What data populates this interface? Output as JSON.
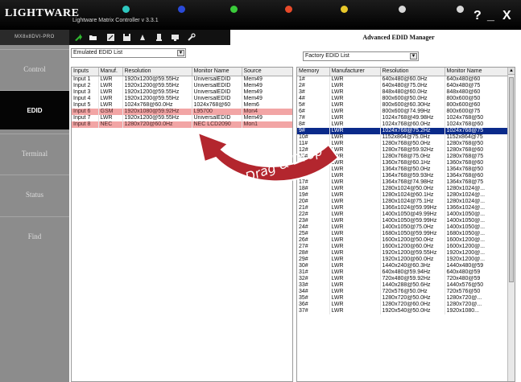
{
  "app": {
    "logo": "LIGHTWARE",
    "title": "Lightware Matrix Controller v 3.3.1",
    "model": "MX8x8DVI-PRO",
    "status_leds": [
      {
        "name": "led-1",
        "color": "#2ec8c0"
      },
      {
        "name": "led-2",
        "color": "#2a4ad8"
      },
      {
        "name": "led-3",
        "color": "#3acb3a"
      },
      {
        "name": "led-4",
        "color": "#e84a2a"
      },
      {
        "name": "led-5",
        "color": "#e8c82a"
      },
      {
        "name": "led-6",
        "color": "#d8d8d8"
      },
      {
        "name": "led-7",
        "color": "#d8d8d8"
      }
    ],
    "help_label": "?",
    "minimize_label": "_",
    "close_label": "X"
  },
  "sidebar": {
    "items": [
      {
        "id": "control",
        "label": "Control",
        "active": false
      },
      {
        "id": "edid",
        "label": "EDID",
        "active": true
      },
      {
        "id": "terminal",
        "label": "Terminal",
        "active": false
      },
      {
        "id": "status",
        "label": "Status",
        "active": false
      },
      {
        "id": "find",
        "label": "Find",
        "active": false
      }
    ]
  },
  "toolbar": {
    "tools": [
      "green-arrow-icon",
      "open-folder-icon",
      "edit-icon",
      "save-icon",
      "paint-icon",
      "document-icon",
      "monitor-icon",
      "wrench-icon"
    ]
  },
  "left": {
    "select_value": "Emulated EDID List",
    "columns": [
      "Inputs",
      "Manuf.",
      "Resolution",
      "Monitor Name",
      "Source"
    ],
    "rows": [
      {
        "cells": [
          "Input 1",
          "LWR",
          "1920x1200@59.55Hz",
          "UniversalEDID",
          "Mem49"
        ],
        "hl": false
      },
      {
        "cells": [
          "Input 2",
          "LWR",
          "1920x1200@59.55Hz",
          "UniversalEDID",
          "Mem49"
        ],
        "hl": false
      },
      {
        "cells": [
          "Input 3",
          "LWR",
          "1920x1200@59.55Hz",
          "UniversalEDID",
          "Mem49"
        ],
        "hl": false
      },
      {
        "cells": [
          "Input 4",
          "LWR",
          "1920x1200@59.55Hz",
          "UniversalEDID",
          "Mem49"
        ],
        "hl": false
      },
      {
        "cells": [
          "Input 5",
          "LWR",
          "1024x768@60.0Hz",
          "1024x768@60",
          "Mem6"
        ],
        "hl": false
      },
      {
        "cells": [
          "Input 6",
          "GSM",
          "1920x1080@59.92Hz",
          "L95700",
          "Mon4"
        ],
        "hl": true
      },
      {
        "cells": [
          "Input 7",
          "LWR",
          "1920x1200@59.55Hz",
          "UniversalEDID",
          "Mem49"
        ],
        "hl": false
      },
      {
        "cells": [
          "Input 8",
          "NEC",
          "1280x720@60.0Hz",
          "NEC LCD2090",
          "Mon1"
        ],
        "hl": true
      }
    ]
  },
  "right": {
    "title": "Advanced EDID Manager",
    "select_value": "Factory EDID List",
    "columns": [
      "Memory",
      "Manufacturer",
      "Resolution",
      "Monitor Name"
    ],
    "selected_row": 8,
    "rows": [
      [
        "1#",
        "LWR",
        "640x480@60.0Hz",
        "640x480@60"
      ],
      [
        "2#",
        "LWR",
        "640x480@75.0Hz",
        "640x480@75"
      ],
      [
        "3#",
        "LWR",
        "848x480@60.0Hz",
        "848x480@60"
      ],
      [
        "4#",
        "LWR",
        "800x600@50.0Hz",
        "800x600@50"
      ],
      [
        "5#",
        "LWR",
        "800x600@60.30Hz",
        "800x600@60"
      ],
      [
        "6#",
        "LWR",
        "800x600@74.99Hz",
        "800x600@75"
      ],
      [
        "7#",
        "LWR",
        "1024x768@49.98Hz",
        "1024x768@50"
      ],
      [
        "8#",
        "LWR",
        "1024x768@60.0Hz",
        "1024x768@60"
      ],
      [
        "9#",
        "LWR",
        "1024x768@75.2Hz",
        "1024x768@75"
      ],
      [
        "10#",
        "LWR",
        "1152x864@75.0Hz",
        "1152x864@75"
      ],
      [
        "11#",
        "LWR",
        "1280x768@50.0Hz",
        "1280x768@50"
      ],
      [
        "12#",
        "LWR",
        "1280x768@59.92Hz",
        "1280x768@60"
      ],
      [
        "13#",
        "LWR",
        "1280x768@75.0Hz",
        "1280x768@75"
      ],
      [
        "14#",
        "LWR",
        "1360x768@60.1Hz",
        "1360x768@60"
      ],
      [
        "15#",
        "LWR",
        "1364x768@50.0Hz",
        "1364x768@50"
      ],
      [
        "16#",
        "LWR",
        "1364x768@59.93Hz",
        "1364x768@60"
      ],
      [
        "17#",
        "LWR",
        "1364x768@74.98Hz",
        "1364x768@75"
      ],
      [
        "18#",
        "LWR",
        "1280x1024@50.0Hz",
        "1280x1024@..."
      ],
      [
        "19#",
        "LWR",
        "1280x1024@60.1Hz",
        "1280x1024@..."
      ],
      [
        "20#",
        "LWR",
        "1280x1024@75.1Hz",
        "1280x1024@..."
      ],
      [
        "21#",
        "LWR",
        "1366x1024@59.99Hz",
        "1366x1024@..."
      ],
      [
        "22#",
        "LWR",
        "1400x1050@49.99Hz",
        "1400x1050@..."
      ],
      [
        "23#",
        "LWR",
        "1400x1050@59.99Hz",
        "1400x1050@..."
      ],
      [
        "24#",
        "LWR",
        "1400x1050@75.0Hz",
        "1400x1050@..."
      ],
      [
        "25#",
        "LWR",
        "1680x1050@59.99Hz",
        "1680x1050@..."
      ],
      [
        "26#",
        "LWR",
        "1600x1200@50.0Hz",
        "1600x1200@..."
      ],
      [
        "27#",
        "LWR",
        "1600x1200@60.0Hz",
        "1600x1200@..."
      ],
      [
        "28#",
        "LWR",
        "1920x1200@59.55Hz",
        "1920x1200@..."
      ],
      [
        "29#",
        "LWR",
        "1920x1200@60.0Hz",
        "1920x1200@..."
      ],
      [
        "30#",
        "LWR",
        "1440x240@60.3Hz",
        "1440x480@59"
      ],
      [
        "31#",
        "LWR",
        "640x480@59.94Hz",
        "640x480@59"
      ],
      [
        "32#",
        "LWR",
        "720x480@59.92Hz",
        "720x480@59"
      ],
      [
        "33#",
        "LWR",
        "1440x288@50.6Hz",
        "1440x576@50"
      ],
      [
        "34#",
        "LWR",
        "720x576@50.0Hz",
        "720x576@50"
      ],
      [
        "35#",
        "LWR",
        "1280x720@50.0Hz",
        "1280x720@..."
      ],
      [
        "36#",
        "LWR",
        "1280x720@60.0Hz",
        "1280x720@..."
      ],
      [
        "37#",
        "LWR",
        "1920x540@50.0Hz",
        "1920x1080..."
      ]
    ]
  },
  "overlay": {
    "drag_drop_label": "Drag & Drop",
    "arrow_color": "#b3262e"
  }
}
